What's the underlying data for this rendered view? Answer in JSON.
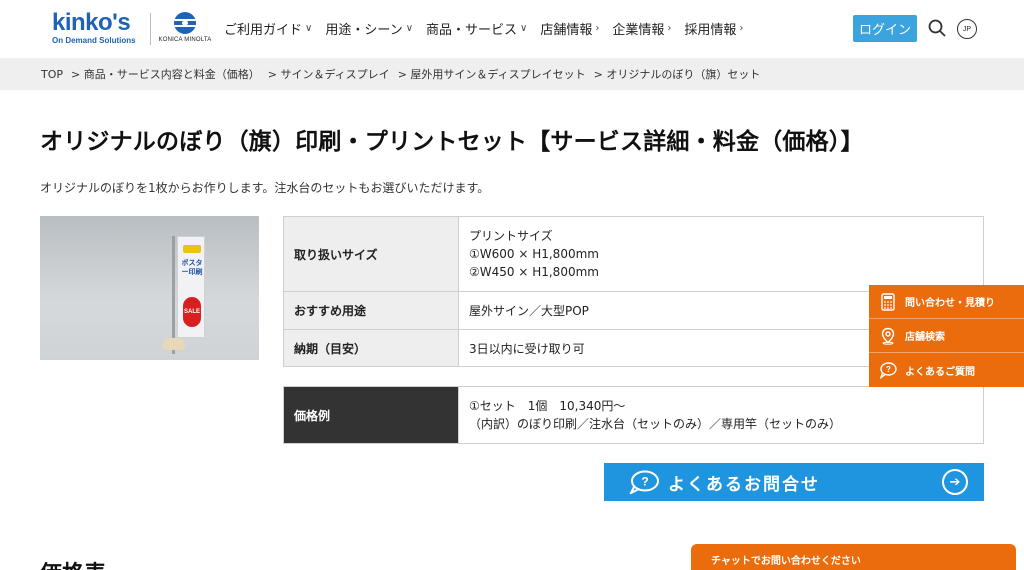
{
  "header": {
    "logo_main": "kinko's",
    "logo_sub": "On Demand Solutions",
    "partner_name": "KONICA MINOLTA",
    "nav": [
      {
        "label": "ご利用ガイド",
        "caret": "∨"
      },
      {
        "label": "用途・シーン",
        "caret": "∨"
      },
      {
        "label": "商品・サービス",
        "caret": "∨"
      },
      {
        "label": "店舗情報",
        "caret": "›"
      },
      {
        "label": "企業情報",
        "caret": "›"
      },
      {
        "label": "採用情報",
        "caret": "›"
      }
    ],
    "login_label": "ログイン",
    "lang_label": "JP",
    "colors": {
      "brand": "#1e63b5",
      "login": "#3ba4de"
    }
  },
  "breadcrumb": [
    "TOP",
    "> 商品・サービス内容と料金（価格）",
    "> サイン＆ディスプレイ",
    "> 屋外用サイン＆ディスプレイセット",
    "> オリジナルのぼり（旗）セット"
  ],
  "main": {
    "title": "オリジナルのぼり（旗）印刷・プリントセット【サービス詳細・料金（価格）】",
    "lead": "オリジナルのぼりを1枚からお作りします。注水台のセットもお選びいただけます。",
    "image": {
      "flag_text": "ポスター印刷",
      "sale_text": "SALE"
    },
    "spec": [
      {
        "key": "取り扱いサイズ",
        "values": [
          "プリントサイズ",
          "①W600 × H1,800mm",
          "②W450 × H1,800mm"
        ]
      },
      {
        "key": "おすすめ用途",
        "values": [
          "屋外サイン／大型POP"
        ]
      },
      {
        "key": "納期（目安）",
        "values": [
          "3日以内に受け取り可"
        ]
      }
    ],
    "price": {
      "key": "価格例",
      "values": [
        "①セット　1個　10,340円〜",
        "（内訳）のぼり印刷／注水台（セットのみ）／専用竿（セットのみ）"
      ]
    },
    "faq_button": {
      "label": "よくあるお問合せ",
      "arrow": "➔",
      "color": "#1f95e0"
    },
    "section_heading": "価格表"
  },
  "side_menu": [
    {
      "label": "問い合わせ・見積り",
      "icon": "calculator-icon"
    },
    {
      "label": "店舗検索",
      "icon": "location-pin-icon"
    },
    {
      "label": "よくあるご質問",
      "icon": "question-bubble-icon"
    }
  ],
  "side_menu_color": "#ea6c0c",
  "chat": {
    "label": "チャットでお問い合わせください"
  }
}
